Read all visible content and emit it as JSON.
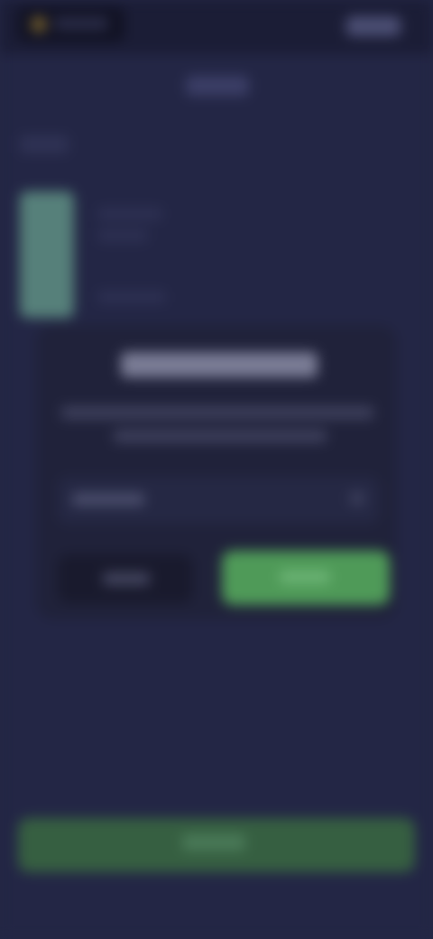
{
  "colors": {
    "background": "#232645",
    "top_bar": "#1b1d36",
    "dialog_background": "#20223a",
    "primary_green": "#4f9a58",
    "bottom_button_green": "#365f41",
    "accent_teal": "#56807a"
  },
  "icons": {
    "top_left_pill_icon": "circle-icon",
    "dialog_select_chevron": "chevron-down-icon"
  }
}
